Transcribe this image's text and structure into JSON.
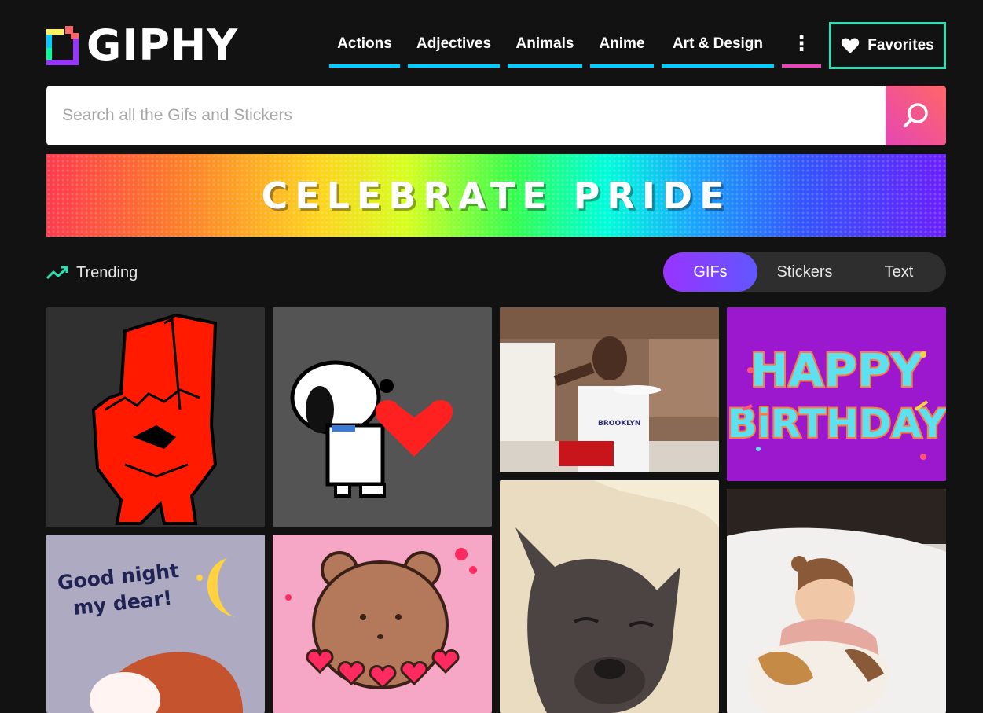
{
  "brand": {
    "name": "GIPHY"
  },
  "nav": {
    "items": [
      {
        "label": "Actions"
      },
      {
        "label": "Adjectives"
      },
      {
        "label": "Animals"
      },
      {
        "label": "Anime"
      },
      {
        "label": "Art & Design"
      }
    ],
    "more_label": "⋮",
    "favorites_label": "Favorites"
  },
  "search": {
    "placeholder": "Search all the Gifs and Stickers",
    "value": ""
  },
  "banner": {
    "text": "CELEBRATE PRIDE"
  },
  "trending": {
    "label": "Trending"
  },
  "content_tabs": [
    {
      "label": "GIFs",
      "active": true
    },
    {
      "label": "Stickers",
      "active": false
    },
    {
      "label": "Text",
      "active": false
    }
  ],
  "gifs": {
    "happy_birthday_text_1": "HAPPY",
    "happy_birthday_text_2": "BiRTHDAY",
    "goodnight_text_1": "Good night",
    "goodnight_text_2": "my dear!",
    "shirt_text": "BROOKLYN"
  },
  "colors": {
    "nav_underline": "#00ccff",
    "more_underline": "#e646b6",
    "favorites_border": "#2cdeb2",
    "tab_active": "#9933ff"
  }
}
